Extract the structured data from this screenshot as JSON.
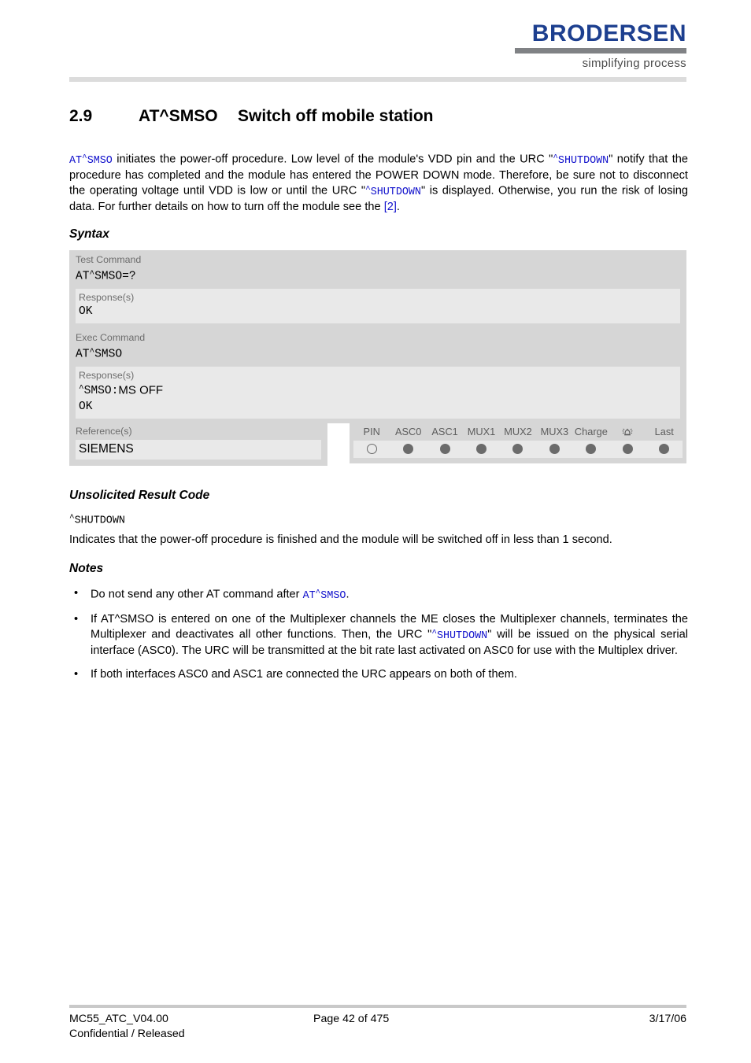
{
  "header": {
    "logo_word": "BRODERSEN",
    "logo_tagline": "simplifying process",
    "brand_color": "#1d3f8f"
  },
  "title": {
    "number": "2.9",
    "command": "AT^SMSO",
    "text": "Switch off mobile station"
  },
  "intro": {
    "seg1_cmd": "AT^SMSO",
    "seg2": " initiates the power-off procedure. Low level of the module's VDD pin and the URC \"",
    "seg3_cmd": "^SHUTDOWN",
    "seg4": "\" notify that the procedure has completed and the module has entered the POWER DOWN mode. Therefore, be sure not to disconnect the operating voltage until VDD is low or until the URC \"",
    "seg5_cmd": "^SHUTDOWN",
    "seg6": "\" is displayed. Otherwise, you run the risk of losing data. For further details on how to turn off the module see the ",
    "xref": "[2]",
    "seg7": "."
  },
  "headings": {
    "syntax": "Syntax",
    "urc": "Unsolicited Result Code",
    "notes": "Notes"
  },
  "syntax": {
    "test": {
      "label": "Test Command",
      "command": "AT^SMSO=?",
      "response_label": "Response(s)",
      "response_lines": [
        "OK"
      ]
    },
    "exec": {
      "label": "Exec Command",
      "command": "AT^SMSO",
      "response_label": "Response(s)",
      "response_prefix": "^SMSO:",
      "response_value": "MS OFF",
      "response_ok": "OK"
    },
    "reference": {
      "label": "Reference(s)",
      "value": "SIEMENS"
    },
    "features": {
      "columns": [
        "PIN",
        "ASC0",
        "ASC1",
        "MUX1",
        "MUX2",
        "MUX3",
        "Charge",
        "alarm-icon",
        "Last"
      ],
      "states": [
        "hollow",
        "filled",
        "filled",
        "filled",
        "filled",
        "filled",
        "filled",
        "filled",
        "filled"
      ],
      "dot_color": "#6b6b6b"
    }
  },
  "urc": {
    "code": "^SHUTDOWN",
    "description": "Indicates that the power-off procedure is finished and the module will be switched off in less than 1 second."
  },
  "notes": [
    {
      "pre": "Do not send any other AT command after ",
      "cmd": "AT^SMSO",
      "post": "."
    },
    {
      "pre": "If AT^SMSO is entered on one of the Multiplexer channels the ME closes the Multiplexer channels, terminates the Multiplexer and deactivates all other functions. Then, the URC \"",
      "cmd": "^SHUTDOWN",
      "post": "\" will be issued on the physical serial interface (ASC0). The URC will be transmitted at the bit rate last activated on ASC0 for use with the Multiplex driver."
    },
    {
      "pre": "If both interfaces ASC0 and ASC1 are connected the URC appears on both of them.",
      "cmd": "",
      "post": ""
    }
  ],
  "footer": {
    "doc_id": "MC55_ATC_V04.00",
    "classification": "Confidential / Released",
    "page": "Page 42 of 475",
    "date": "3/17/06"
  }
}
